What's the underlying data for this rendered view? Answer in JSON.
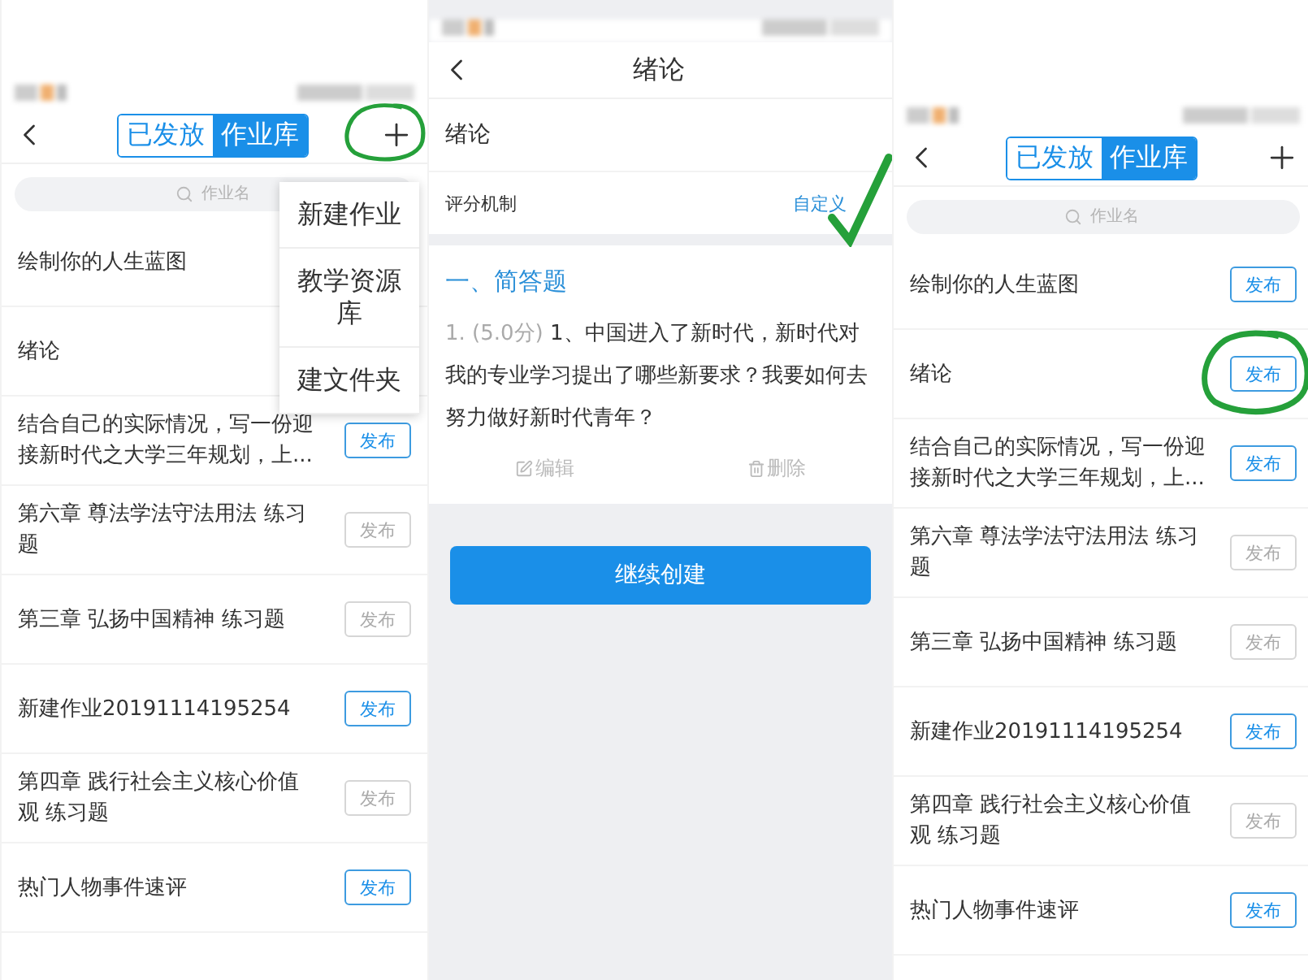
{
  "panels": [
    {
      "kind": "list",
      "tabs": [
        {
          "label": "已发放",
          "selected": false
        },
        {
          "label": "作业库",
          "selected": true
        }
      ],
      "add_annotated": true,
      "search": {
        "placeholder": "作业名"
      },
      "menu": [
        {
          "label": "新建作业"
        },
        {
          "label": "教学资源库"
        },
        {
          "label": "建文件夹"
        }
      ],
      "rows": [
        {
          "title": "绘制你的人生蓝图"
        },
        {
          "title": "绪论"
        },
        {
          "title": "结合自己的实际情况，写一份迎接新时代之大学三年规划，上...",
          "button": "发布",
          "enabled": true,
          "annotated": false
        },
        {
          "title": "第六章 尊法学法守法用法 练习题",
          "button": "发布",
          "enabled": false,
          "annotated": false
        },
        {
          "title": "第三章 弘扬中国精神 练习题",
          "button": "发布",
          "enabled": false,
          "annotated": false
        },
        {
          "title": "新建作业20191114195254",
          "button": "发布",
          "enabled": true,
          "annotated": false
        },
        {
          "title": "第四章 践行社会主义核心价值观 练习题",
          "button": "发布",
          "enabled": false,
          "annotated": false
        },
        {
          "title": "热门人物事件速评",
          "button": "发布",
          "enabled": true,
          "annotated": false
        }
      ]
    },
    {
      "kind": "editor",
      "title": "绪论",
      "name": "绪论",
      "scoring": {
        "label": "评分机制",
        "value": "自定义",
        "annotated": true
      },
      "section": "一、简答题",
      "question": {
        "number": "1. (5.0分)",
        "text": "1、中国进入了新时代，新时代对我的专业学习提出了哪些新要求？我要如何去努力做好新时代青年？"
      },
      "actions": [
        {
          "kind": "edit",
          "label": "编辑"
        },
        {
          "kind": "delete",
          "label": "删除"
        }
      ],
      "primary_button": "继续创建"
    },
    {
      "kind": "list",
      "tabs": [
        {
          "label": "已发放",
          "selected": false
        },
        {
          "label": "作业库",
          "selected": true
        }
      ],
      "add_annotated": false,
      "search": {
        "placeholder": "作业名"
      },
      "rows": [
        {
          "title": "绘制你的人生蓝图",
          "button": "发布",
          "enabled": true,
          "annotated": false
        },
        {
          "title": "绪论",
          "button": "发布",
          "enabled": true,
          "annotated": true
        },
        {
          "title": "结合自己的实际情况，写一份迎接新时代之大学三年规划，上...",
          "button": "发布",
          "enabled": true,
          "annotated": false
        },
        {
          "title": "第六章 尊法学法守法用法 练习题",
          "button": "发布",
          "enabled": false,
          "annotated": false
        },
        {
          "title": "第三章 弘扬中国精神 练习题",
          "button": "发布",
          "enabled": false,
          "annotated": false
        },
        {
          "title": "新建作业20191114195254",
          "button": "发布",
          "enabled": true,
          "annotated": false
        },
        {
          "title": "第四章 践行社会主义核心价值观 练习题",
          "button": "发布",
          "enabled": false,
          "annotated": false
        },
        {
          "title": "热门人物事件速评",
          "button": "发布",
          "enabled": true,
          "annotated": false
        }
      ]
    }
  ]
}
